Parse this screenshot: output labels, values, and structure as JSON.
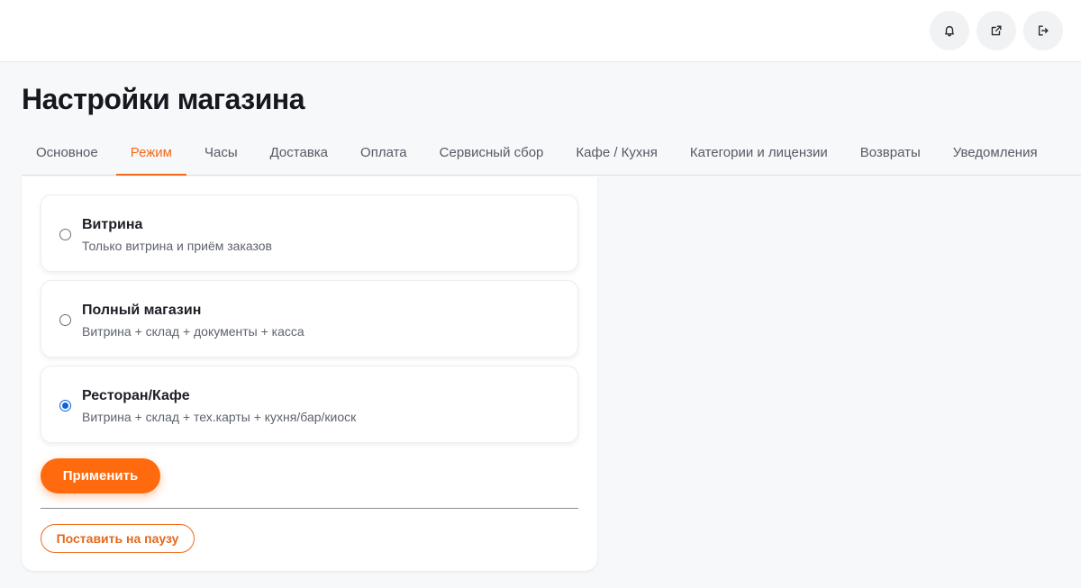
{
  "header": {
    "icons": [
      "bell-icon",
      "external-link-icon",
      "logout-icon"
    ]
  },
  "page": {
    "title": "Настройки магазина"
  },
  "tabs": [
    {
      "label": "Основное",
      "active": false
    },
    {
      "label": "Режим",
      "active": true
    },
    {
      "label": "Часы",
      "active": false
    },
    {
      "label": "Доставка",
      "active": false
    },
    {
      "label": "Оплата",
      "active": false
    },
    {
      "label": "Сервисный сбор",
      "active": false
    },
    {
      "label": "Кафе / Кухня",
      "active": false
    },
    {
      "label": "Категории и лицензии",
      "active": false
    },
    {
      "label": "Возвраты",
      "active": false
    },
    {
      "label": "Уведомления",
      "active": false
    }
  ],
  "mode": {
    "selected": "Ресторан/Кафе",
    "options": [
      {
        "title": "Витрина",
        "description": "Только витрина и приём заказов",
        "checked": false
      },
      {
        "title": "Полный магазин",
        "description": "Витрина + склад + документы + касса",
        "checked": false
      },
      {
        "title": "Ресторан/Кафе",
        "description": "Витрина + склад + тех.карты + кухня/бар/киоск",
        "checked": true
      }
    ],
    "apply_label": "Применить",
    "pause_label": "Поставить на паузу"
  },
  "colors": {
    "accent": "#ff6a0f",
    "active_tab": "#f26a1b",
    "radio_checked": "#0b65d8",
    "background": "#f7f8fa"
  }
}
